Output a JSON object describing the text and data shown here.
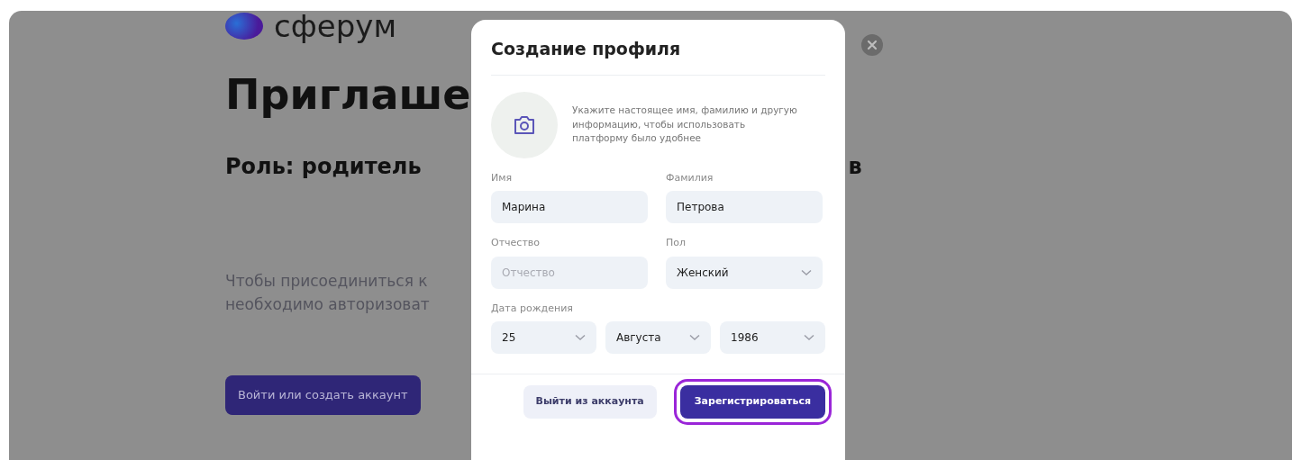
{
  "background": {
    "logo": "сферум",
    "title": "Приглаше",
    "role": "Роль: родитель",
    "role_tail": "в",
    "description": [
      "Чтобы присоединиться к",
      "необходимо авторизоват"
    ],
    "button": "Войти или создать аккаунт"
  },
  "modal": {
    "title": "Создание профиля",
    "hint": "Укажите настоящее имя, фамилию и другую информацию, чтобы использовать платформу было удобнее",
    "fields": [
      {
        "label": "Имя",
        "value": "Марина",
        "kind": "input"
      },
      {
        "label": "Фамилия",
        "value": "Петрова",
        "kind": "input"
      },
      {
        "label": "Отчество",
        "placeholder": "Отчество",
        "kind": "input"
      },
      {
        "label": "Пол",
        "value": "Женский",
        "kind": "select"
      }
    ],
    "birth_date": {
      "label": "Дата рождения",
      "parts": [
        "25",
        "Августа",
        "1986"
      ]
    },
    "buttons": [
      {
        "label": "Выйти из аккаунта",
        "kind": "secondary",
        "focused": false
      },
      {
        "label": "Зарегистрироваться",
        "kind": "primary",
        "focused": true
      }
    ]
  }
}
